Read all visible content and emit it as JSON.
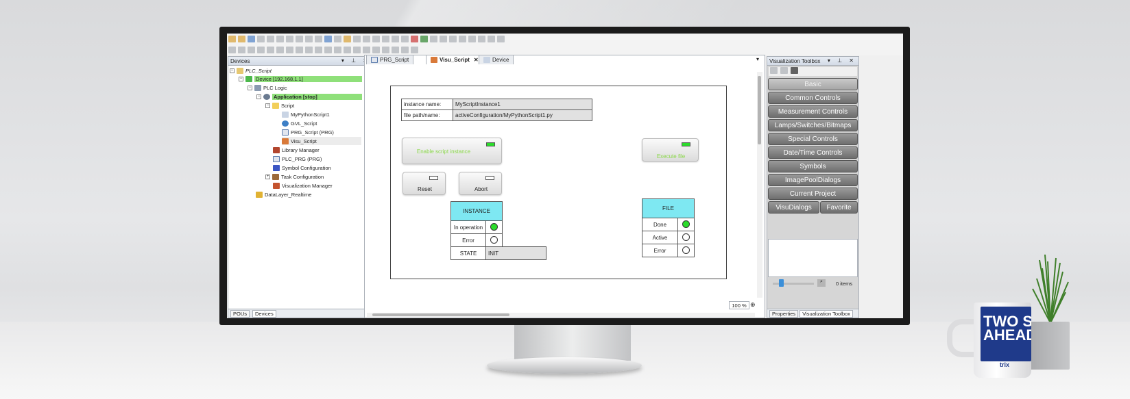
{
  "mug": {
    "text_line1": "TWO S",
    "text_line2": "AHEAD",
    "brand": "trix"
  },
  "devices_panel": {
    "title": "Devices",
    "tree": [
      {
        "label": "PLC_Script",
        "italic": true
      },
      {
        "label": "Device [192.168.1.1]",
        "highlight": true
      },
      {
        "label": "PLC Logic"
      },
      {
        "label": "Application [stop]",
        "highlight": true,
        "bold": true
      },
      {
        "label": "Script"
      },
      {
        "label": "MyPythonScript1"
      },
      {
        "label": "GVL_Script"
      },
      {
        "label": "PRG_Script (PRG)"
      },
      {
        "label": "Visu_Script",
        "selected": true
      },
      {
        "label": "Library Manager"
      },
      {
        "label": "PLC_PRG (PRG)"
      },
      {
        "label": "Symbol Configuration"
      },
      {
        "label": "Task Configuration"
      },
      {
        "label": "Visualization Manager"
      },
      {
        "label": "DataLayer_Realtime"
      }
    ],
    "bottom_tabs": [
      "POUs",
      "Devices"
    ]
  },
  "editor": {
    "tabs": [
      "PRG_Script",
      "Visu_Script",
      "Device"
    ],
    "active_tab": "Visu_Script",
    "zoom": "100 %",
    "visu": {
      "instance_name_label": "instance name:",
      "instance_name_value": "MyScriptInstance1",
      "file_path_label": "file path/name:",
      "file_path_value": "activeConfiguration/MyPythonScript1.py",
      "enable_button": "Enable script instance",
      "execute_button": "Execute file",
      "reset_button": "Reset",
      "abort_button": "Abort",
      "instance_header": "INSTANCE",
      "instance_rows": [
        "In operation",
        "Error",
        "STATE"
      ],
      "state_value": "INIT",
      "file_header": "FILE",
      "file_rows": [
        "Done",
        "Active",
        "Error"
      ]
    }
  },
  "toolbox": {
    "title": "Visualization Toolbox",
    "buttons": [
      "Basic",
      "Common Controls",
      "Measurement Controls",
      "Lamps/Switches/Bitmaps",
      "Special Controls",
      "Date/Time Controls",
      "Symbols",
      "ImagePoolDialogs",
      "Current Project"
    ],
    "half_buttons": [
      "VisuDialogs",
      "Favorite"
    ],
    "items_count": "0 items",
    "bottom_tabs": [
      "Properties",
      "Visualization Toolbox"
    ]
  },
  "colors": {
    "highlight_green": "#8fe07a",
    "lamp_green": "#2bdc2b",
    "header_cyan": "#7ee8f2",
    "button_text_green": "#8bd84b"
  }
}
